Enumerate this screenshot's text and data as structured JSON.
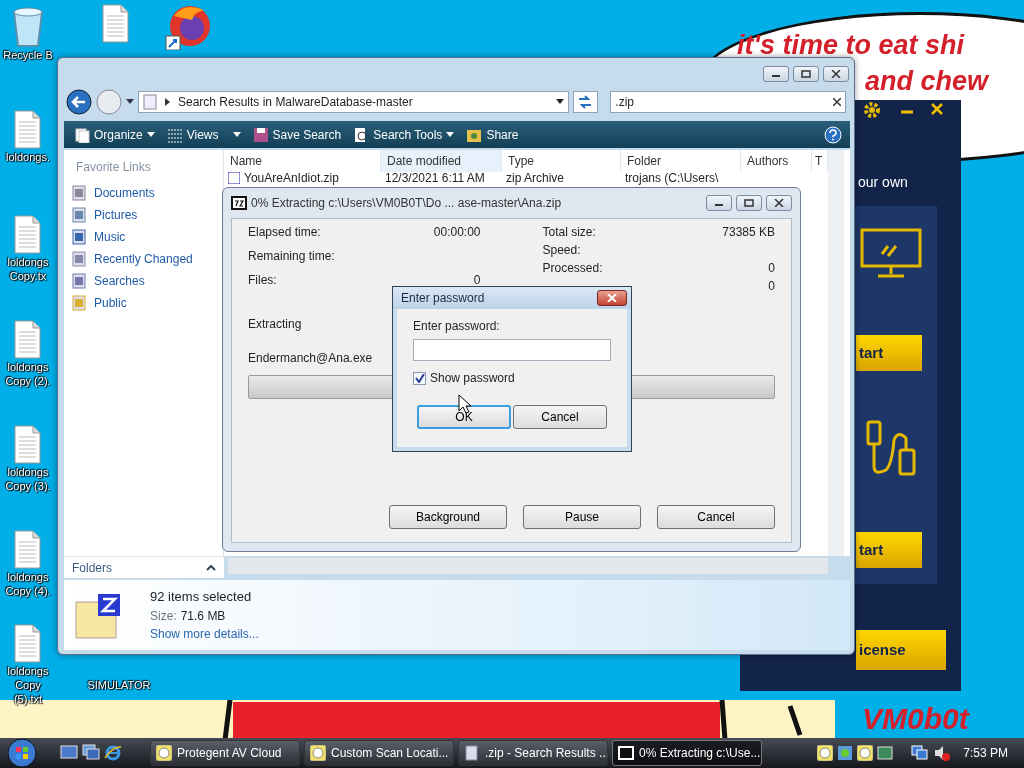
{
  "desktop_icons": [
    {
      "kind": "recycle",
      "label": "Recycle B"
    },
    {
      "kind": "file"
    },
    {
      "kind": "browser"
    },
    {
      "kind": "file",
      "label": "loldongs."
    },
    {
      "kind": "file",
      "label": "loldongs Copy.tx"
    },
    {
      "kind": "file",
      "label": "loldongs Copy (2)."
    },
    {
      "kind": "file",
      "label": "loldongs Copy (3)."
    },
    {
      "kind": "file",
      "label": "loldongs Copy (4)."
    },
    {
      "kind": "file",
      "label": "loldongs Copy (5).txt"
    },
    {
      "kind": "text",
      "label": "SIMULATOR"
    }
  ],
  "wallpaper": {
    "bubble_lines": [
      "it's time to eat shi",
      "and chew"
    ],
    "signature": "VM0b0t"
  },
  "av_window": {
    "caption": "our own",
    "buttons": [
      "tart",
      "tart",
      "icense"
    ]
  },
  "explorer": {
    "address": "Search Results in MalwareDatabase-master",
    "search": ".zip",
    "toolbar": [
      {
        "label": "Organize",
        "kind": "menu"
      },
      {
        "label": "Views",
        "kind": "menu"
      },
      {
        "label": "Save Search",
        "kind": "plain"
      },
      {
        "label": "Search Tools",
        "kind": "menu"
      },
      {
        "label": "Share",
        "kind": "plain"
      }
    ],
    "favorites_title": "Favorite Links",
    "favorites": [
      "Documents",
      "Pictures",
      "Music",
      "Recently Changed",
      "Searches",
      "Public"
    ],
    "columns": [
      {
        "label": "Name",
        "hover": false
      },
      {
        "label": "Date modified",
        "hover": true
      },
      {
        "label": "Type",
        "hover": false
      },
      {
        "label": "Folder",
        "hover": false
      },
      {
        "label": "Authors",
        "hover": false
      },
      {
        "label": "T",
        "hover": false
      }
    ],
    "rows": [
      [
        "YouAreAnIdiot.zip",
        "12/3/2021 6:11 AM",
        "zip Archive",
        "trojans (C:\\Users\\"
      ]
    ],
    "folders": "Folders",
    "details": {
      "title": "92 items selected",
      "size_label": "Size:",
      "size": "71.6 MB",
      "link": "Show more details..."
    }
  },
  "extract": {
    "title": "0% Extracting c:\\Users\\VM0B0T\\Do ... ase-master\\Ana.zip",
    "left": [
      {
        "label": "Elapsed time:",
        "value": "00:00:00"
      },
      {
        "label": "Remaining time:"
      },
      {
        "label": "Files:",
        "value": "0"
      }
    ],
    "right": [
      {
        "label": "Total size:",
        "value": "73385 KB"
      },
      {
        "label": "Speed:"
      },
      {
        "label": "Processed:",
        "value": "0"
      },
      {
        "value": "0"
      }
    ],
    "status": "Extracting",
    "file": "Endermanch@Ana.exe",
    "level": 0,
    "buttons": [
      "Background",
      "Pause",
      "Cancel"
    ]
  },
  "password": {
    "title": "Enter password",
    "label": "Enter password:",
    "show_password": {
      "label": "Show password",
      "checked": true
    },
    "buttons": [
      {
        "label": "OK",
        "default": true
      },
      {
        "label": "Cancel",
        "default": false
      }
    ]
  },
  "taskbar": {
    "tasks": [
      {
        "label": "Protegent AV Cloud",
        "kind": "p",
        "selected": false
      },
      {
        "label": "Custom Scan Locati...",
        "kind": "p",
        "selected": false
      },
      {
        "label": ".zip - Search Results ...",
        "kind": "search",
        "selected": false
      },
      {
        "label": "0% Extracting c:\\Use...",
        "kind": "archive",
        "selected": true
      }
    ],
    "time": "7:53 PM"
  }
}
